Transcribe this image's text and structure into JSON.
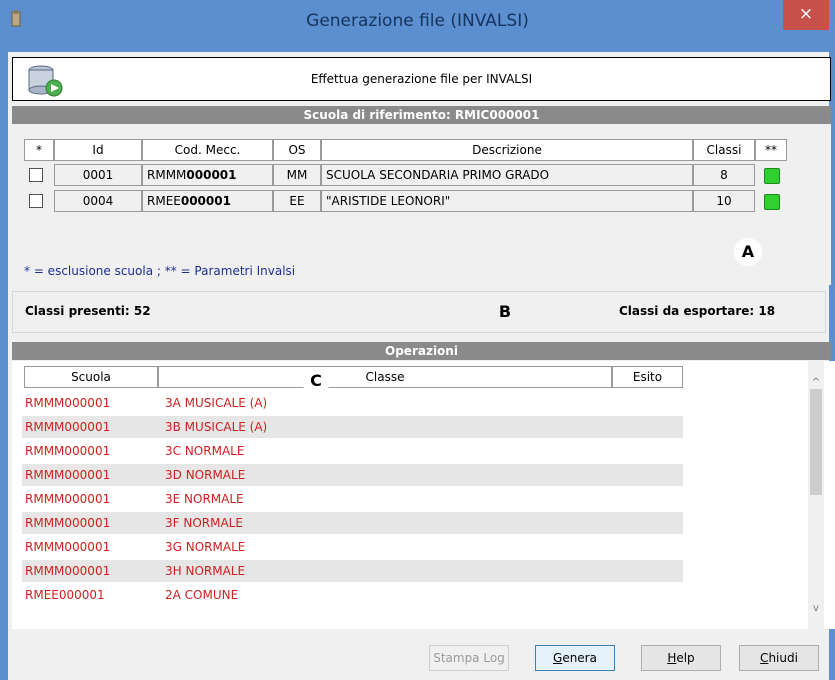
{
  "window": {
    "title": "Generazione file (INVALSI)",
    "close_glyph": "×"
  },
  "header": {
    "text": "Effettua generazione file per INVALSI",
    "icon": "database-export-icon"
  },
  "school_section": {
    "title": "Scuola di riferimento: RMIC000001"
  },
  "schools_table": {
    "columns": [
      "*",
      "Id",
      "Cod. Mecc.",
      "OS",
      "Descrizione",
      "Classi",
      "**"
    ],
    "rows": [
      {
        "id": "0001",
        "cod_prefix": "RMMM",
        "cod_suffix": "000001",
        "os": "MM",
        "descrizione": "SCUOLA SECONDARIA PRIMO GRADO",
        "classi": "8",
        "checked": false,
        "param_color": "#2fd02f"
      },
      {
        "id": "0004",
        "cod_prefix": "RMEE",
        "cod_suffix": "000001",
        "os": "EE",
        "descrizione": "\"ARISTIDE LEONORI\"",
        "classi": "10",
        "checked": false,
        "param_color": "#2fd02f"
      }
    ]
  },
  "legend": "* = esclusione scuola ; ** = Parametri Invalsi",
  "annotations": {
    "a": "A",
    "b": "B",
    "c": "C"
  },
  "stats": {
    "present": "Classi presenti: 52",
    "to_export": "Classi da esportare: 18"
  },
  "operations": {
    "title": "Operazioni",
    "columns": [
      "Scuola",
      "Classe",
      "Esito"
    ],
    "rows": [
      {
        "scuola": "RMMM000001",
        "classe": "3A MUSICALE (A)",
        "esito": ""
      },
      {
        "scuola": "RMMM000001",
        "classe": "3B MUSICALE (A)",
        "esito": ""
      },
      {
        "scuola": "RMMM000001",
        "classe": "3C NORMALE",
        "esito": ""
      },
      {
        "scuola": "RMMM000001",
        "classe": "3D NORMALE",
        "esito": ""
      },
      {
        "scuola": "RMMM000001",
        "classe": "3E NORMALE",
        "esito": ""
      },
      {
        "scuola": "RMMM000001",
        "classe": "3F NORMALE",
        "esito": ""
      },
      {
        "scuola": "RMMM000001",
        "classe": "3G NORMALE",
        "esito": ""
      },
      {
        "scuola": "RMMM000001",
        "classe": "3H NORMALE",
        "esito": ""
      },
      {
        "scuola": "RMEE000001",
        "classe": "2A COMUNE",
        "esito": ""
      }
    ],
    "text_color": "#d21f1f",
    "scroll_up_glyph": "^",
    "scroll_down_glyph": "v"
  },
  "buttons": {
    "stampa_log": "Stampa Log",
    "genera_first": "G",
    "genera_rest": "enera",
    "help_first": "H",
    "help_rest": "elp",
    "chiudi_first": "C",
    "chiudi_rest": "hiudi"
  },
  "colors": {
    "title_bar": "#5b8fd0",
    "section_bar": "#8a8a8a",
    "close": "#c7504b"
  }
}
